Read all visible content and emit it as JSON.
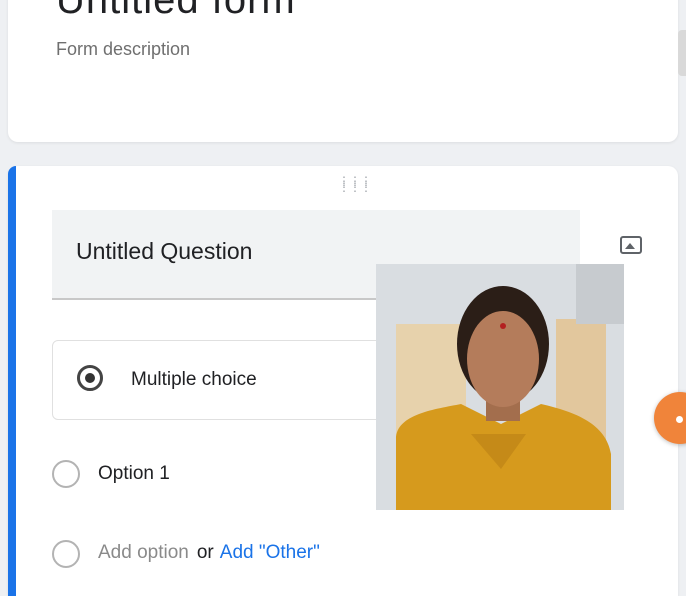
{
  "form": {
    "title": "Untitled form",
    "description": "Form description"
  },
  "question": {
    "title": "Untitled Question",
    "type": "Multiple choice",
    "options": [
      "Option 1"
    ],
    "add_option": "Add option",
    "or": "or",
    "add_other": "Add \"Other\""
  },
  "colors": {
    "accent": "#1a73e8",
    "fab": "#f0843a"
  },
  "icons": [
    "drag-handle-icon",
    "image-icon",
    "radio-button-icon"
  ]
}
